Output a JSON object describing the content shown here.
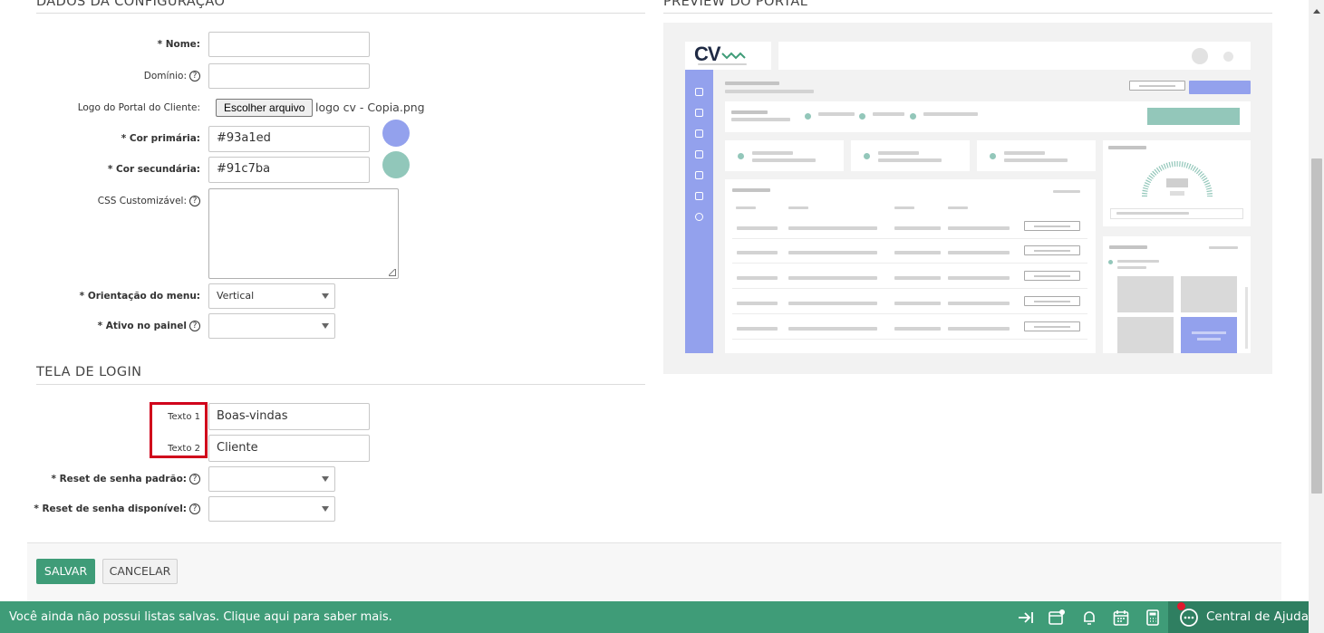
{
  "sections": {
    "config_title": "DADOS DA CONFIGURAÇÃO",
    "preview_title": "PREVIEW DO PORTAL",
    "login_title": "TELA DE LOGIN"
  },
  "form": {
    "nome": {
      "label": "* Nome:",
      "value": ""
    },
    "dominio": {
      "label": "Domínio:",
      "value": ""
    },
    "logo": {
      "label": "Logo do Portal do Cliente:",
      "button": "Escolher arquivo",
      "filename": "logo cv - Copia.png"
    },
    "cor_primaria": {
      "label": "* Cor primária:",
      "value": "#93a1ed"
    },
    "cor_secundaria": {
      "label": "* Cor secundária:",
      "value": "#91c7ba"
    },
    "css": {
      "label": "CSS Customizável:",
      "value": ""
    },
    "orientacao": {
      "label": "* Orientação do menu:",
      "value": "Vertical"
    },
    "ativo": {
      "label": "* Ativo no painel",
      "value": ""
    }
  },
  "login": {
    "texto1": {
      "label": "Texto 1",
      "value": "Boas-vindas"
    },
    "texto2": {
      "label": "Texto 2",
      "value": "Cliente"
    },
    "reset_padrao": {
      "label": "* Reset de senha padrão:",
      "value": ""
    },
    "reset_disponivel": {
      "label": "* Reset de senha disponível:",
      "value": ""
    }
  },
  "help_glyph": "?",
  "actions": {
    "save": "SALVAR",
    "cancel": "CANCELAR"
  },
  "bottombar": {
    "message": "Você ainda não possui listas salvas. Clique aqui para saber mais.",
    "help_center": "Central de Ajuda"
  },
  "preview": {
    "logo_text": "CV",
    "primary_color": "#93a1ed",
    "secondary_color": "#93c7ba"
  },
  "colors": {
    "accent_green": "#3f9c78",
    "highlight_red": "#d0021b"
  }
}
